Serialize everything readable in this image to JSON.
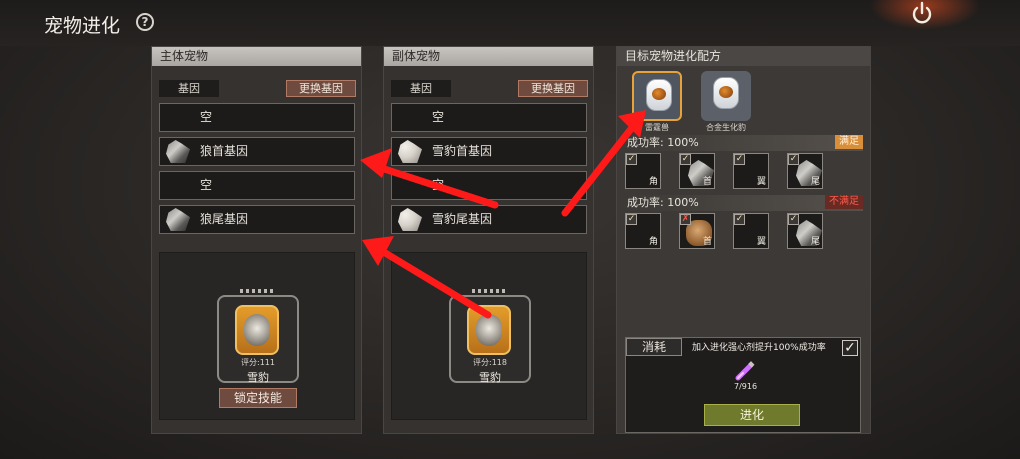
{
  "header": {
    "title": "宠物进化",
    "help_icon": "?"
  },
  "main_pet": {
    "panel_title": "主体宠物",
    "gene_label": "基因",
    "swap_label": "更换基因",
    "slots": [
      {
        "text": "空",
        "icon": ""
      },
      {
        "text": "狼首基因",
        "icon": "wolf-icon"
      },
      {
        "text": "空",
        "icon": ""
      },
      {
        "text": "狼尾基因",
        "icon": "wolf-icon"
      }
    ],
    "card": {
      "score": "评分:111",
      "name": "雪豹"
    },
    "lock_label": "锁定技能"
  },
  "sub_pet": {
    "panel_title": "副体宠物",
    "gene_label": "基因",
    "swap_label": "更换基因",
    "slots": [
      {
        "text": "空",
        "icon": ""
      },
      {
        "text": "雪豹首基因",
        "icon": "leopard-icon"
      },
      {
        "text": "空",
        "icon": ""
      },
      {
        "text": "雪豹尾基因",
        "icon": "leopard-icon"
      }
    ],
    "card": {
      "score": "评分:118",
      "name": "雪豹"
    }
  },
  "recipe": {
    "panel_title": "目标宠物进化配方",
    "targets": [
      {
        "name": "雷霆兽",
        "selected": true
      },
      {
        "name": "合金生化豹",
        "selected": false
      }
    ],
    "requirements": [
      {
        "rate": "成功率: 100%",
        "status": "满足",
        "status_type": "ok",
        "parts": [
          {
            "label": "角",
            "check": "✓",
            "icon": ""
          },
          {
            "label": "首",
            "check": "✓",
            "icon": "wolf-icon"
          },
          {
            "label": "翼",
            "check": "✓",
            "icon": ""
          },
          {
            "label": "尾",
            "check": "✓",
            "icon": "wolf-icon"
          }
        ]
      },
      {
        "rate": "成功率: 100%",
        "status": "不满足",
        "status_type": "bad",
        "parts": [
          {
            "label": "角",
            "check": "✓",
            "icon": ""
          },
          {
            "label": "首",
            "check": "✗",
            "icon": "dog-icon"
          },
          {
            "label": "翼",
            "check": "✓",
            "icon": ""
          },
          {
            "label": "尾",
            "check": "✓",
            "icon": "wolf-icon"
          }
        ]
      }
    ],
    "consume": {
      "tab": "消耗",
      "note": "加入进化强心剂提升100%成功率",
      "checked": "✓",
      "potion_count": "7/916",
      "evolve_label": "进化"
    }
  },
  "colors": {
    "accent_orange": "#e7a23a",
    "swap_button": "#6f4a3e",
    "evolve_button": "#6f7a2c",
    "ok_status": "#d98f3a",
    "bad_status": "#ff5a4a",
    "arrow_red": "#ff1a1a"
  }
}
